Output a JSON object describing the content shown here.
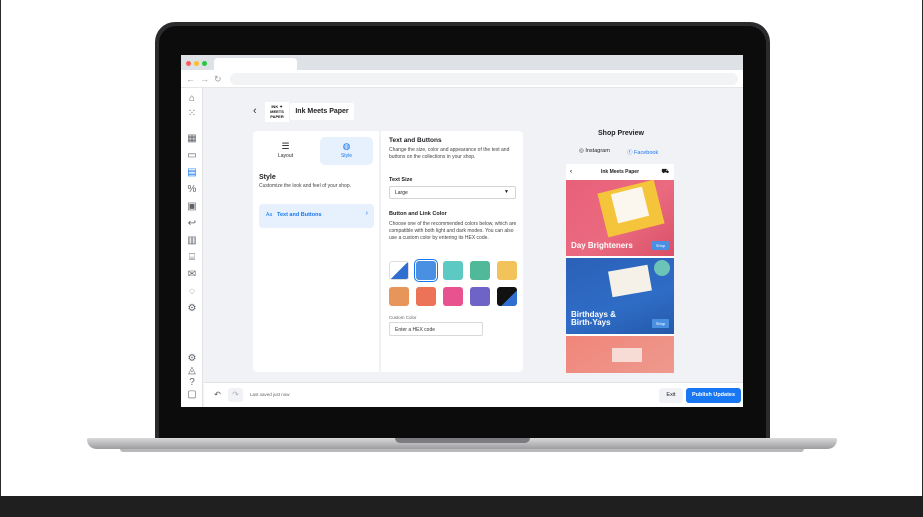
{
  "brand": {
    "logo_text": "INK ✦ MEETS PAPER",
    "title": "Ink Meets Paper"
  },
  "left_panel": {
    "tabs": [
      {
        "label": "Layout",
        "icon": "list-icon"
      },
      {
        "label": "Style",
        "icon": "palette-icon"
      }
    ],
    "section_title": "Style",
    "section_subtitle": "Customize the look and feel of your shop.",
    "selected_item": {
      "prefix": "Aa",
      "label": "Text and Buttons"
    }
  },
  "middle_panel": {
    "title": "Text and Buttons",
    "description": "Change the size, color and appearance of the text and buttons on the collections in your shop.",
    "text_size_label": "Text Size",
    "text_size_value": "Large",
    "color_label": "Button and Link Color",
    "color_description": "Choose one of the recommended colors below, which are compatible with both light and dark modes. You can also use a custom color by entering its HEX code.",
    "swatches": [
      "#2f6fd0",
      "#4a90e2",
      "#5cc9c3",
      "#52b89a",
      "#f2c35a",
      "#e8955a",
      "#ec7358",
      "#e8528f",
      "#6e63c7",
      "#111111"
    ],
    "selected_swatch": 1,
    "custom_color_label": "Custom Color",
    "hex_placeholder": "Enter a HEX code"
  },
  "preview": {
    "title": "Shop Preview",
    "tabs": [
      {
        "label": "Instagram",
        "icon": "instagram-icon"
      },
      {
        "label": "Facebook",
        "icon": "facebook-icon"
      }
    ],
    "phone_title": "Ink Meets Paper",
    "tiles": [
      {
        "title": "Day Brighteners",
        "button": "Shop"
      },
      {
        "title": "Birthdays & Birth-Yays",
        "button": "Shop"
      }
    ]
  },
  "footer": {
    "saved_text": "Last saved just now",
    "exit_label": "Exit",
    "publish_label": "Publish Updates"
  },
  "colors": {
    "accent": "#1877f2",
    "active_bg": "#e7f0fd"
  }
}
